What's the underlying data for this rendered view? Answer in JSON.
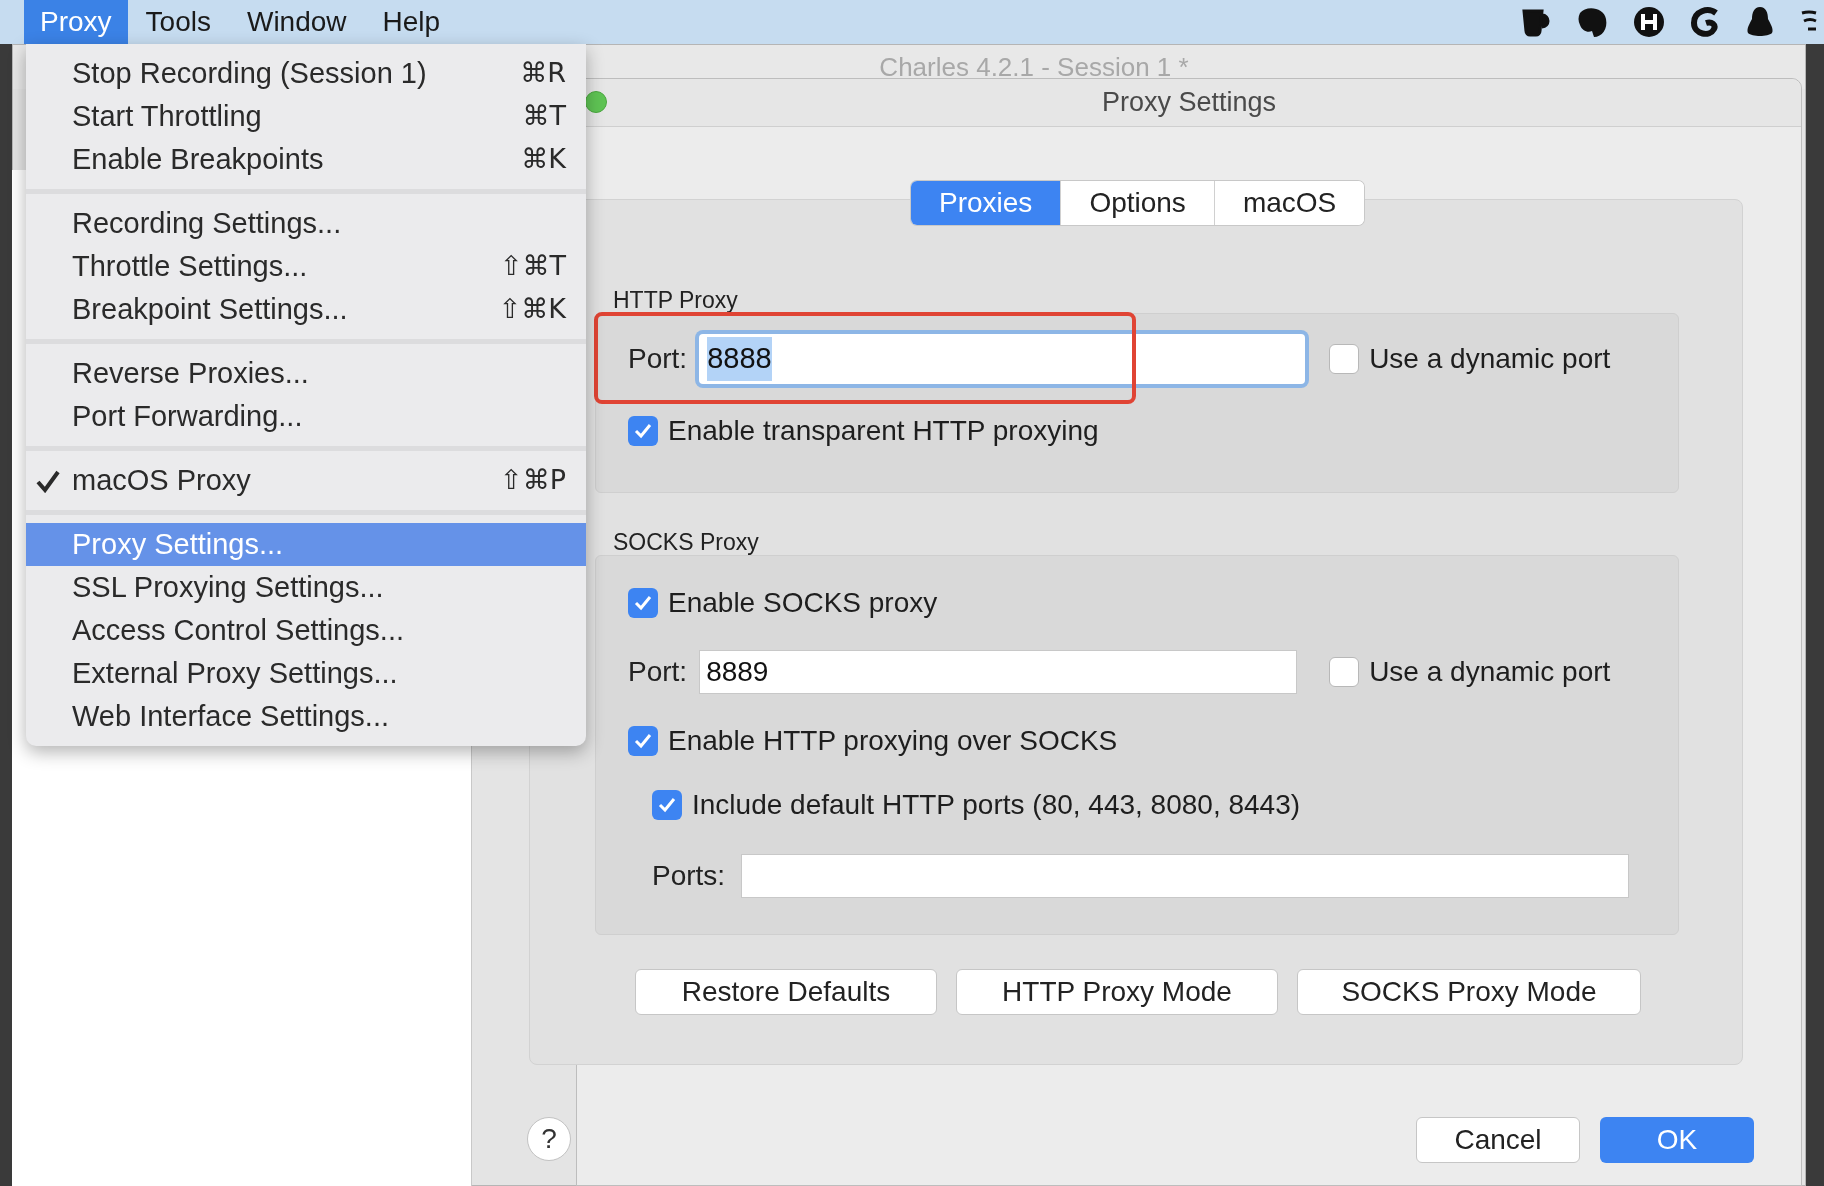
{
  "menu_bar": {
    "items": [
      {
        "label": "Proxy",
        "selected": true
      },
      {
        "label": "Tools",
        "selected": false
      },
      {
        "label": "Window",
        "selected": false
      },
      {
        "label": "Help",
        "selected": false
      }
    ]
  },
  "menu": {
    "sections": [
      [
        {
          "label": "Stop Recording (Session 1)",
          "shortcut": "⌘R",
          "checked": false,
          "selected": false
        },
        {
          "label": "Start Throttling",
          "shortcut": "⌘T",
          "checked": false,
          "selected": false
        },
        {
          "label": "Enable Breakpoints",
          "shortcut": "⌘K",
          "checked": false,
          "selected": false
        }
      ],
      [
        {
          "label": "Recording Settings...",
          "checked": false,
          "selected": false
        },
        {
          "label": "Throttle Settings...",
          "shortcut": "⇧⌘T",
          "checked": false,
          "selected": false
        },
        {
          "label": "Breakpoint Settings...",
          "shortcut": "⇧⌘K",
          "checked": false,
          "selected": false
        }
      ],
      [
        {
          "label": "Reverse Proxies...",
          "checked": false,
          "selected": false
        },
        {
          "label": "Port Forwarding...",
          "checked": false,
          "selected": false
        }
      ],
      [
        {
          "label": "macOS Proxy",
          "shortcut": "⇧⌘P",
          "checked": true,
          "selected": false
        }
      ],
      [
        {
          "label": "Proxy Settings...",
          "checked": false,
          "selected": true
        },
        {
          "label": "SSL Proxying Settings...",
          "checked": false,
          "selected": false
        },
        {
          "label": "Access Control Settings...",
          "checked": false,
          "selected": false
        },
        {
          "label": "External Proxy Settings...",
          "checked": false,
          "selected": false
        },
        {
          "label": "Web Interface Settings...",
          "checked": false,
          "selected": false
        }
      ]
    ]
  },
  "background_window": {
    "title": "Charles 4.2.1 - Session 1 *"
  },
  "dialog": {
    "title": "Proxy Settings",
    "tabs": [
      {
        "label": "Proxies",
        "selected": true
      },
      {
        "label": "Options",
        "selected": false
      },
      {
        "label": "macOS",
        "selected": false
      }
    ],
    "http_proxy": {
      "heading": "HTTP Proxy",
      "port_label": "Port:",
      "port": "8888",
      "dynamic_port": {
        "label": "Use a dynamic port",
        "checked": false
      },
      "transparent": {
        "label": "Enable transparent HTTP proxying",
        "checked": true
      }
    },
    "socks_proxy": {
      "heading": "SOCKS Proxy",
      "enable": {
        "label": "Enable SOCKS proxy",
        "checked": true
      },
      "port_label": "Port:",
      "port": "8889",
      "dynamic_port": {
        "label": "Use a dynamic port",
        "checked": false
      },
      "http_over_socks": {
        "label": "Enable HTTP proxying over SOCKS",
        "checked": true
      },
      "include_default": {
        "label": "Include default HTTP ports (80, 443, 8080, 8443)",
        "checked": true
      },
      "ports_label": "Ports:"
    },
    "mode_buttons": [
      "Restore Defaults",
      "HTTP Proxy Mode",
      "SOCKS Proxy Mode"
    ],
    "help": "?",
    "cancel": "Cancel",
    "ok": "OK"
  }
}
